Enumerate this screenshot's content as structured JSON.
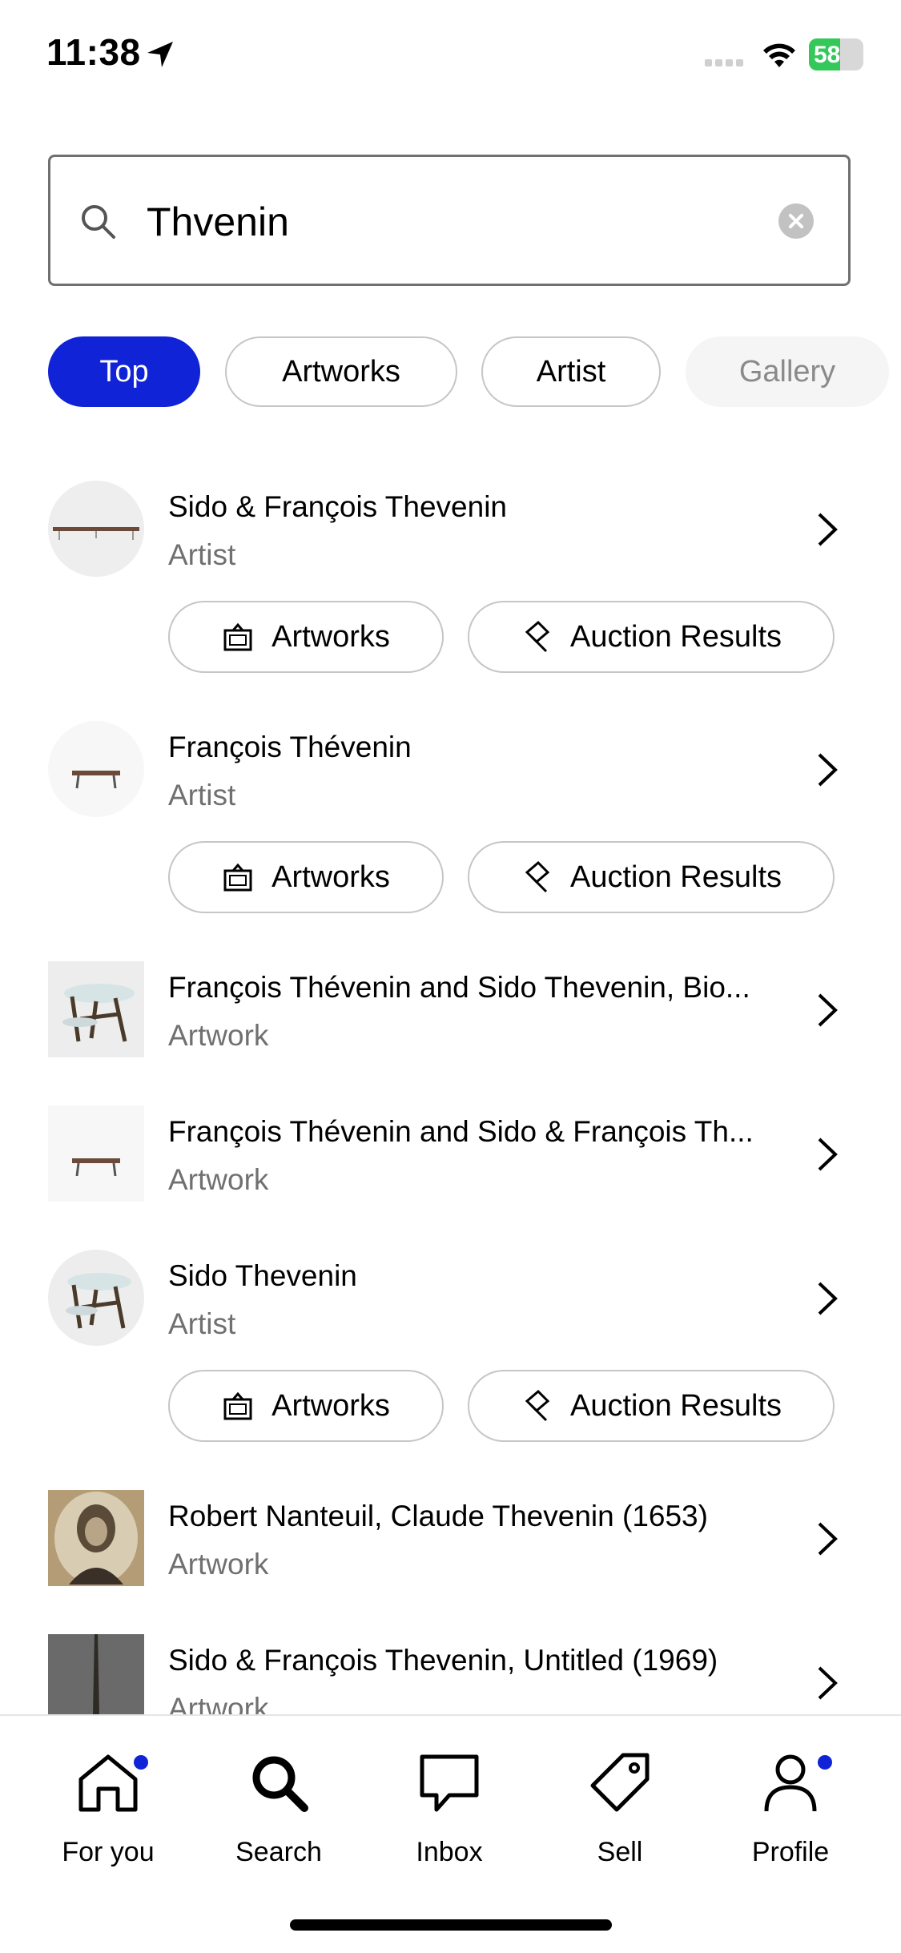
{
  "status_bar": {
    "time": "11:38",
    "battery": "58"
  },
  "search": {
    "query": "Thvenin"
  },
  "filters": [
    "Top",
    "Artworks",
    "Artist",
    "Gallery"
  ],
  "actions": {
    "artworks": "Artworks",
    "auction_results": "Auction Results"
  },
  "results": [
    {
      "title": "Sido & François Thevenin",
      "type": "Artist"
    },
    {
      "title": "François Thévenin",
      "type": "Artist"
    },
    {
      "title": "François Thévenin and Sido Thevenin, Bio...",
      "type": "Artwork"
    },
    {
      "title": "François Thévenin and Sido & François Th...",
      "type": "Artwork"
    },
    {
      "title": "Sido Thevenin",
      "type": "Artist"
    },
    {
      "title": "Robert Nanteuil, Claude Thevenin (1653)",
      "type": "Artwork"
    },
    {
      "title": "Sido & François Thevenin, Untitled (1969)",
      "type": "Artwork"
    }
  ],
  "tabs": [
    "For you",
    "Search",
    "Inbox",
    "Sell",
    "Profile"
  ],
  "colors": {
    "accent": "#1023d7",
    "battery": "#34c759"
  }
}
